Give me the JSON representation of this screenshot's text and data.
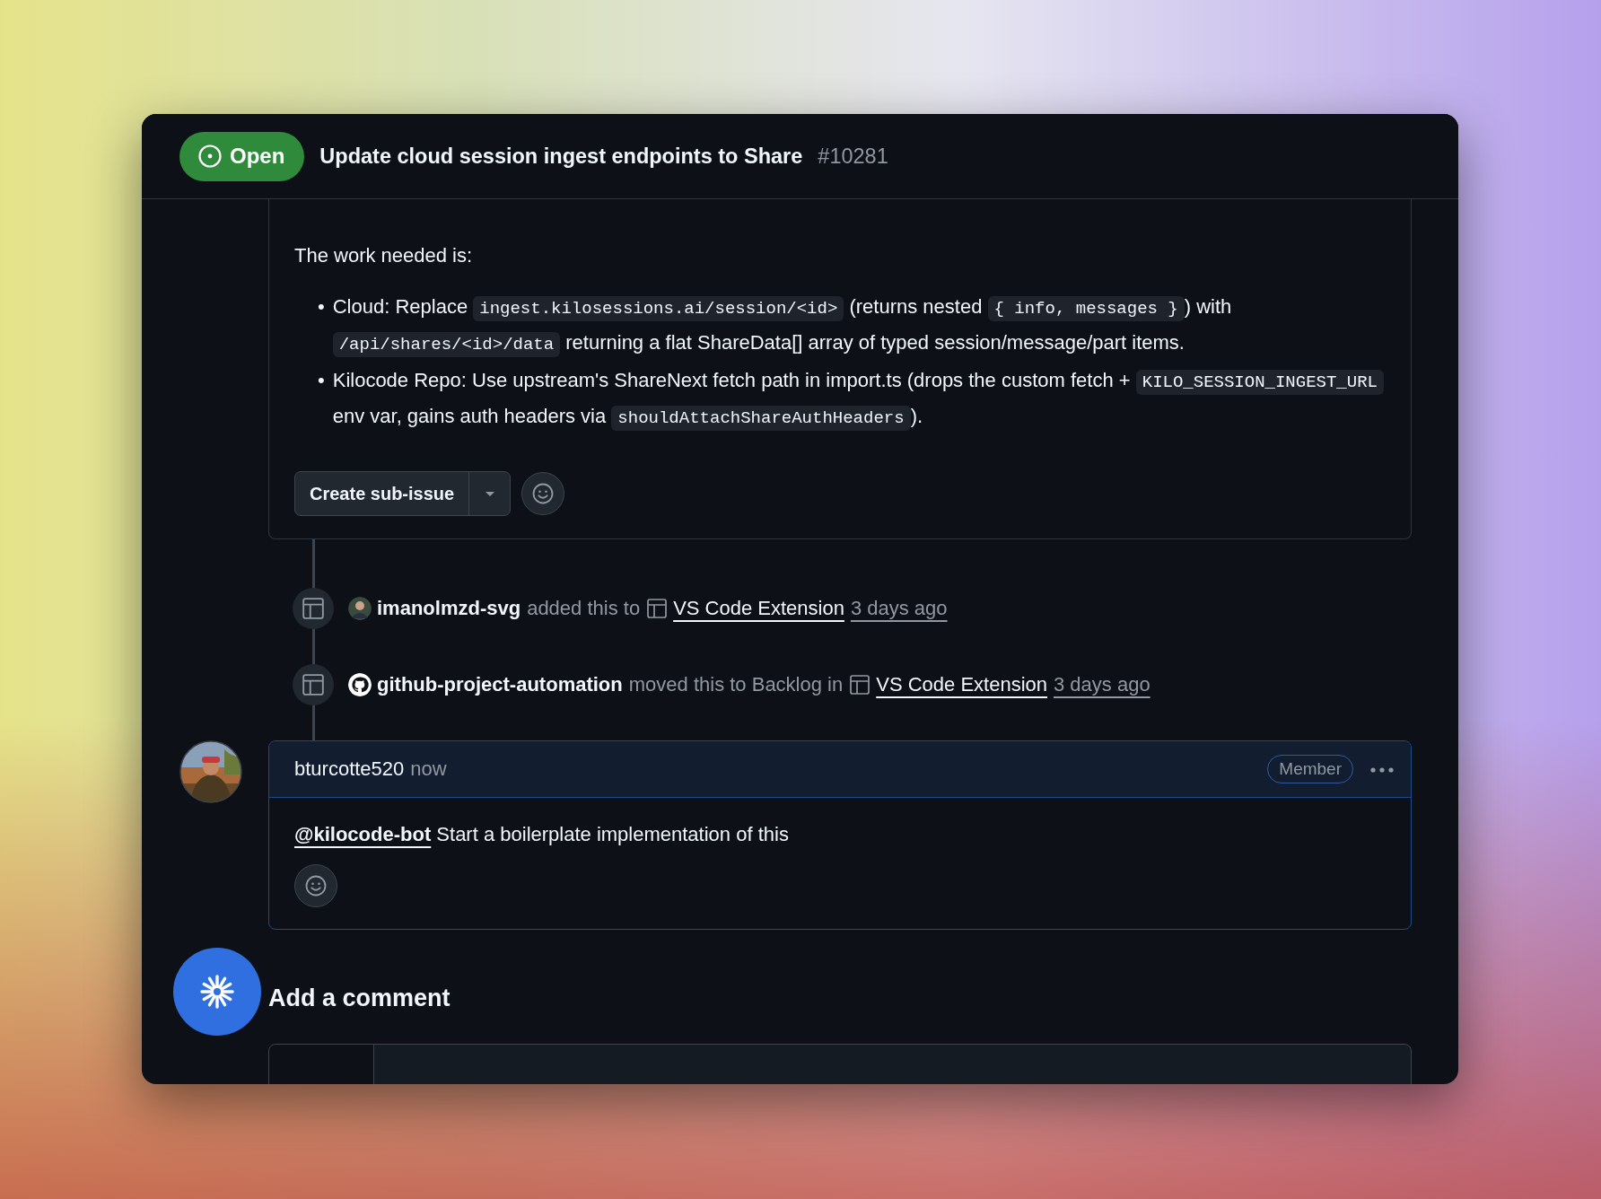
{
  "issue": {
    "state": "Open",
    "title": "Update cloud session ingest endpoints to Share",
    "number": "#10281"
  },
  "body": {
    "intro": "The work needed is:",
    "bullets": [
      {
        "marker": "•",
        "parts": [
          {
            "kind": "text",
            "text": "Cloud: Replace "
          },
          {
            "kind": "code",
            "text": "ingest.kilosessions.ai/session/<id>"
          },
          {
            "kind": "text",
            "text": " (returns nested "
          },
          {
            "kind": "code",
            "text": "{ info, messages }"
          },
          {
            "kind": "text",
            "text": ") with "
          },
          {
            "kind": "code",
            "text": "/api/shares/<id>/data"
          },
          {
            "kind": "text",
            "text": " returning a flat ShareData[] array of typed session/message/part items."
          }
        ]
      },
      {
        "marker": "•",
        "parts": [
          {
            "kind": "text",
            "text": "Kilocode Repo: Use upstream's ShareNext fetch path in import.ts (drops the custom fetch + "
          },
          {
            "kind": "code",
            "text": "KILO_SESSION_INGEST_URL"
          },
          {
            "kind": "text",
            "text": " env var, gains auth headers via "
          },
          {
            "kind": "code",
            "text": "shouldAttachShareAuthHeaders"
          },
          {
            "kind": "text",
            "text": ")."
          }
        ]
      }
    ],
    "create_button": "Create sub-issue"
  },
  "events": [
    {
      "kind": "user",
      "actor": "imanolmzd-svg",
      "action": "added this to",
      "project": "VS Code Extension",
      "time": "3 days ago"
    },
    {
      "kind": "github",
      "actor": "github-project-automation",
      "action": "moved this to Backlog in",
      "project": "VS Code Extension",
      "time": "3 days ago"
    }
  ],
  "comment": {
    "author": "bturcotte520",
    "time": "now",
    "badge": "Member",
    "mention": "@kilocode-bot",
    "text": " Start a boilerplate implementation of this"
  },
  "add_comment": {
    "heading": "Add a comment"
  }
}
